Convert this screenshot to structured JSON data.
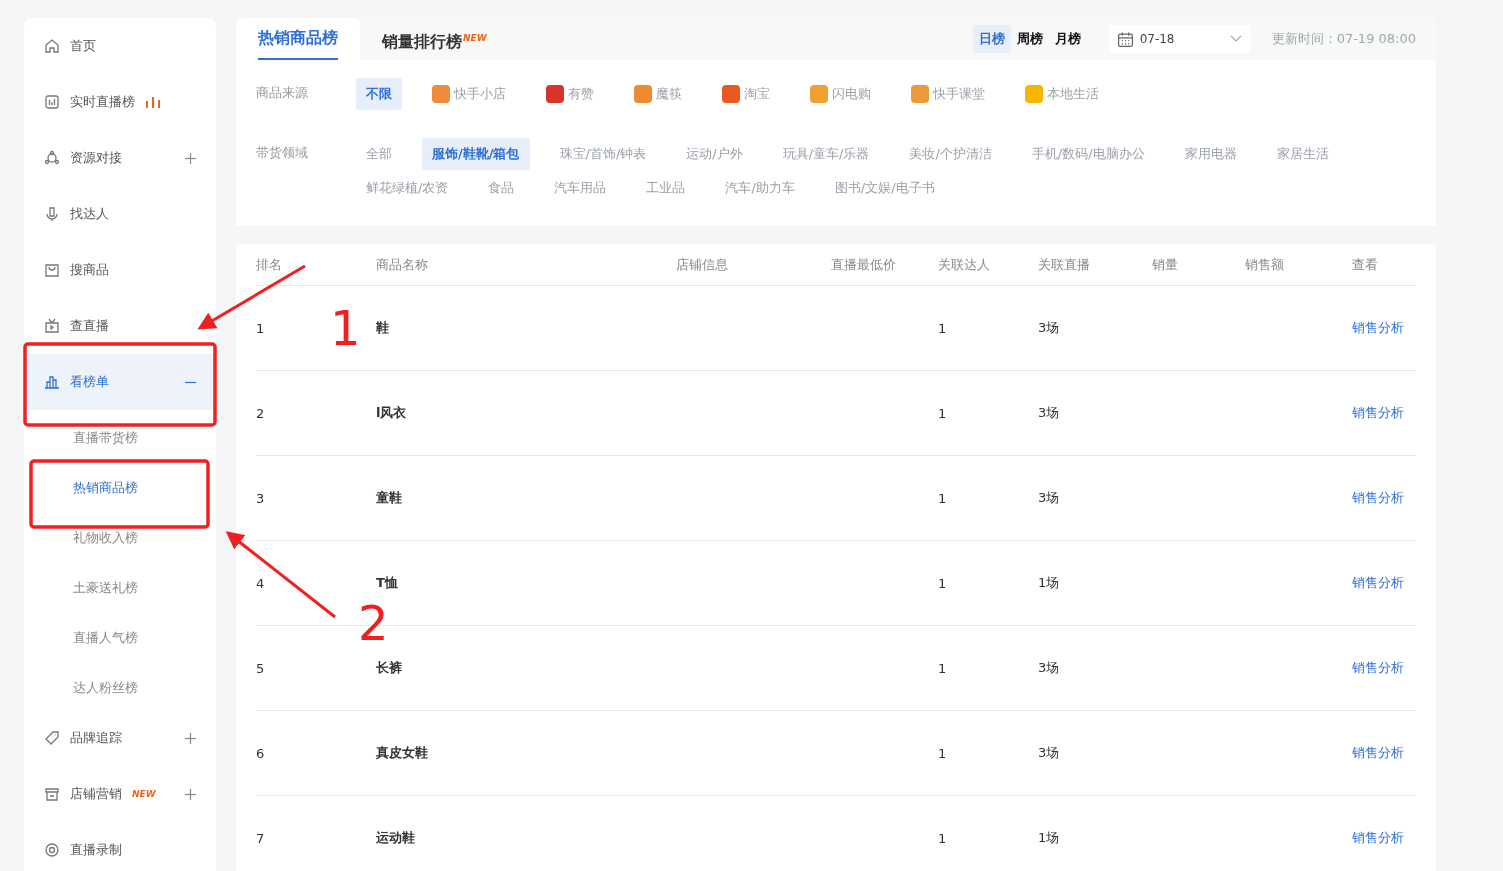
{
  "sidebar": {
    "items": [
      {
        "label": "首页",
        "selected": false
      },
      {
        "label": "实时直播榜",
        "selected": false
      },
      {
        "label": "资源对接",
        "expanded": false,
        "selected": false
      },
      {
        "label": "找达人",
        "selected": false
      },
      {
        "label": "搜商品",
        "selected": false
      },
      {
        "label": "查直播",
        "selected": false
      },
      {
        "label": "看榜单",
        "expanded": true,
        "selected": true,
        "children": [
          {
            "label": "直播带货榜",
            "selected": false
          },
          {
            "label": "热销商品榜",
            "selected": true
          },
          {
            "label": "礼物收入榜",
            "selected": false
          },
          {
            "label": "土豪送礼榜",
            "selected": false
          },
          {
            "label": "直播人气榜",
            "selected": false
          },
          {
            "label": "达人粉丝榜",
            "selected": false
          }
        ]
      },
      {
        "label": "品牌追踪",
        "expanded": false,
        "selected": false
      },
      {
        "label": "店铺营销",
        "badge": "NEW",
        "expanded": false,
        "selected": false
      },
      {
        "label": "直播录制",
        "selected": false
      }
    ]
  },
  "tabs": [
    {
      "label": "热销商品榜",
      "selected": true
    },
    {
      "label": "销量排行榜",
      "badge": "NEW",
      "selected": false
    }
  ],
  "periods": [
    {
      "label": "日榜",
      "selected": true
    },
    {
      "label": "周榜",
      "selected": false
    },
    {
      "label": "月榜",
      "selected": false
    }
  ],
  "date_select": {
    "value": "07-18"
  },
  "update_time": "更新时间：07-19 08:00",
  "filters": {
    "source": {
      "label": "商品来源",
      "options": [
        {
          "label": "不限",
          "selected": true
        },
        {
          "label": "快手小店",
          "selected": false,
          "color": "#f08a3c"
        },
        {
          "label": "有赞",
          "selected": false,
          "color": "#d8342c"
        },
        {
          "label": "魔筷",
          "selected": false,
          "color": "#ee8a30"
        },
        {
          "label": "淘宝",
          "selected": false,
          "color": "#ea5a20"
        },
        {
          "label": "闪电购",
          "selected": false,
          "color": "#f0a030"
        },
        {
          "label": "快手课堂",
          "selected": false,
          "color": "#eb9a3a"
        },
        {
          "label": "本地生活",
          "selected": false,
          "color": "#f7b500"
        }
      ]
    },
    "category": {
      "label": "带货领域",
      "options": [
        {
          "label": "全部",
          "selected": false
        },
        {
          "label": "服饰/鞋靴/箱包",
          "selected": true
        },
        {
          "label": "珠宝/首饰/钟表",
          "selected": false
        },
        {
          "label": "运动/户外",
          "selected": false
        },
        {
          "label": "玩具/童车/乐器",
          "selected": false
        },
        {
          "label": "美妆/个护清洁",
          "selected": false
        },
        {
          "label": "手机/数码/电脑办公",
          "selected": false
        },
        {
          "label": "家用电器",
          "selected": false
        },
        {
          "label": "家居生活",
          "selected": false
        },
        {
          "label": "鲜花绿植/农资",
          "selected": false
        },
        {
          "label": "食品",
          "selected": false
        },
        {
          "label": "汽车用品",
          "selected": false
        },
        {
          "label": "工业品",
          "selected": false
        },
        {
          "label": "汽车/助力车",
          "selected": false
        },
        {
          "label": "图书/文娱/电子书",
          "selected": false
        }
      ]
    }
  },
  "table": {
    "columns": [
      "排名",
      "商品名称",
      "店铺信息",
      "直播最低价",
      "关联达人",
      "关联直播",
      "销量",
      "销售额",
      "查看"
    ],
    "rows": [
      {
        "rank": "1",
        "name": "鞋",
        "creators": "1",
        "lives": "3场",
        "action": "销售分析"
      },
      {
        "rank": "2",
        "name": "l风衣",
        "creators": "1",
        "lives": "3场",
        "action": "销售分析"
      },
      {
        "rank": "3",
        "name": "童鞋",
        "creators": "1",
        "lives": "3场",
        "action": "销售分析"
      },
      {
        "rank": "4",
        "name": "T恤",
        "creators": "1",
        "lives": "1场",
        "action": "销售分析"
      },
      {
        "rank": "5",
        "name": "长裤",
        "creators": "1",
        "lives": "3场",
        "action": "销售分析"
      },
      {
        "rank": "6",
        "name": "真皮女鞋",
        "creators": "1",
        "lives": "3场",
        "action": "销售分析"
      },
      {
        "rank": "7",
        "name": "运动鞋",
        "creators": "1",
        "lives": "1场",
        "action": "销售分析"
      }
    ]
  },
  "annotations": [
    {
      "label": "1"
    },
    {
      "label": "2"
    }
  ]
}
